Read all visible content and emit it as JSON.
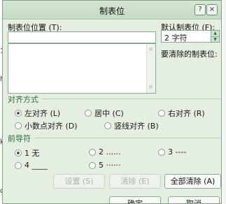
{
  "dialog": {
    "title": "制表位",
    "help_label": "?",
    "close_label": "×"
  },
  "tab_position": {
    "label": "制表位位置 (T):",
    "value": ""
  },
  "default_tab": {
    "label": "默认制表位 (F):",
    "value": "2 字符"
  },
  "clear_label": "要清除的制表位:",
  "alignment": {
    "title": "对齐方式",
    "options": [
      "左对齐 (L)",
      "居中 (C)",
      "右对齐 (R)",
      "小数点对齐 (D)",
      "竖线对齐 (B)"
    ],
    "selected": "左对齐 (L)"
  },
  "leader": {
    "title": "前导符",
    "options": [
      "1 无",
      "2 ......",
      "3 ----",
      "4 ____",
      "5 ······"
    ],
    "selected": "1 无"
  },
  "buttons": {
    "set": "设置 (S)",
    "clear": "清除 (E)",
    "clear_all": "全部清除 (A)",
    "ok": "确定",
    "cancel": "取消"
  },
  "backdrop": {
    "text_1": "1",
    "text_2": "h",
    "text_3": "k",
    "text_4": "d"
  },
  "colors": {
    "accent": "#2f6b3a",
    "dialog_bg": "#e4efe1",
    "border": "#7f9f88"
  }
}
